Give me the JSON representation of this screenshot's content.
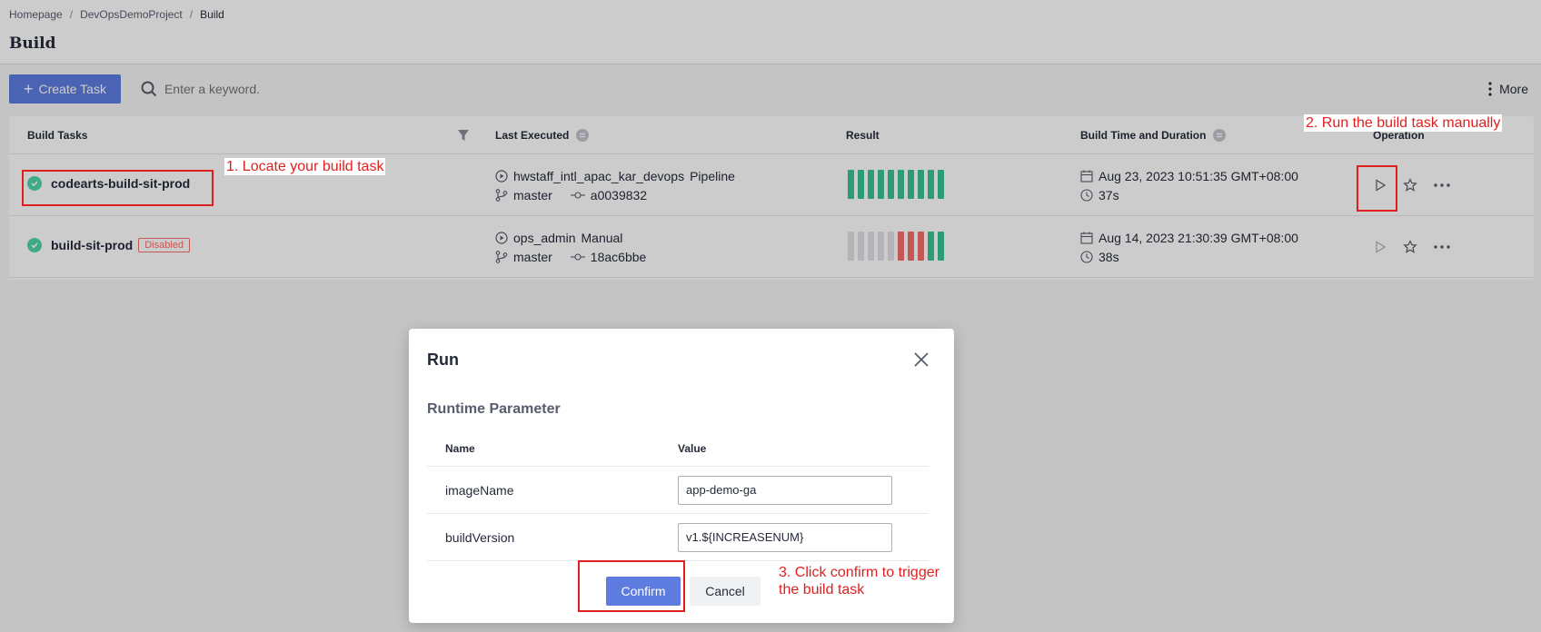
{
  "breadcrumb": {
    "home": "Homepage",
    "project": "DevOpsDemoProject",
    "current": "Build",
    "separator": "/"
  },
  "page": {
    "title": "Build"
  },
  "toolbar": {
    "create_label": "Create Task",
    "search_placeholder": "Enter a keyword.",
    "more_label": "More"
  },
  "table": {
    "headers": {
      "tasks": "Build Tasks",
      "last_executed": "Last Executed",
      "result": "Result",
      "time": "Build Time and Duration",
      "operation": "Operation"
    },
    "rows": [
      {
        "name": "codearts-build-sit-prod",
        "badge": "",
        "executor": "hwstaff_intl_apac_kar_devops",
        "trigger": "Pipeline",
        "branch": "master",
        "commit": "a0039832",
        "date": "Aug 23, 2023 10:51:35 GMT+08:00",
        "duration": "37s",
        "results": [
          "pass",
          "pass",
          "pass",
          "pass",
          "pass",
          "pass",
          "pass",
          "pass",
          "pass",
          "pass"
        ]
      },
      {
        "name": "build-sit-prod",
        "badge": "Disabled",
        "executor": "ops_admin",
        "trigger": "Manual",
        "branch": "master",
        "commit": "18ac6bbe",
        "date": "Aug 14, 2023 21:30:39 GMT+08:00",
        "duration": "38s",
        "results": [
          "none",
          "none",
          "none",
          "none",
          "none",
          "fail",
          "fail",
          "fail",
          "pass",
          "pass"
        ]
      }
    ]
  },
  "modal": {
    "title": "Run",
    "section": "Runtime Parameter",
    "col_name": "Name",
    "col_value": "Value",
    "params": [
      {
        "name": "imageName",
        "value": "app-demo-ga"
      },
      {
        "name": "buildVersion",
        "value": "v1.${INCREASENUM}"
      }
    ],
    "confirm_label": "Confirm",
    "cancel_label": "Cancel"
  },
  "annotations": {
    "step1": "1. Locate your build task",
    "step2": "2. Run the build task manually",
    "step3": "3. Click confirm to trigger the build task"
  },
  "colors": {
    "accent": "#5e7ce0",
    "success": "#3ac295",
    "danger": "#f66f6a",
    "annotation": "#e02020"
  }
}
